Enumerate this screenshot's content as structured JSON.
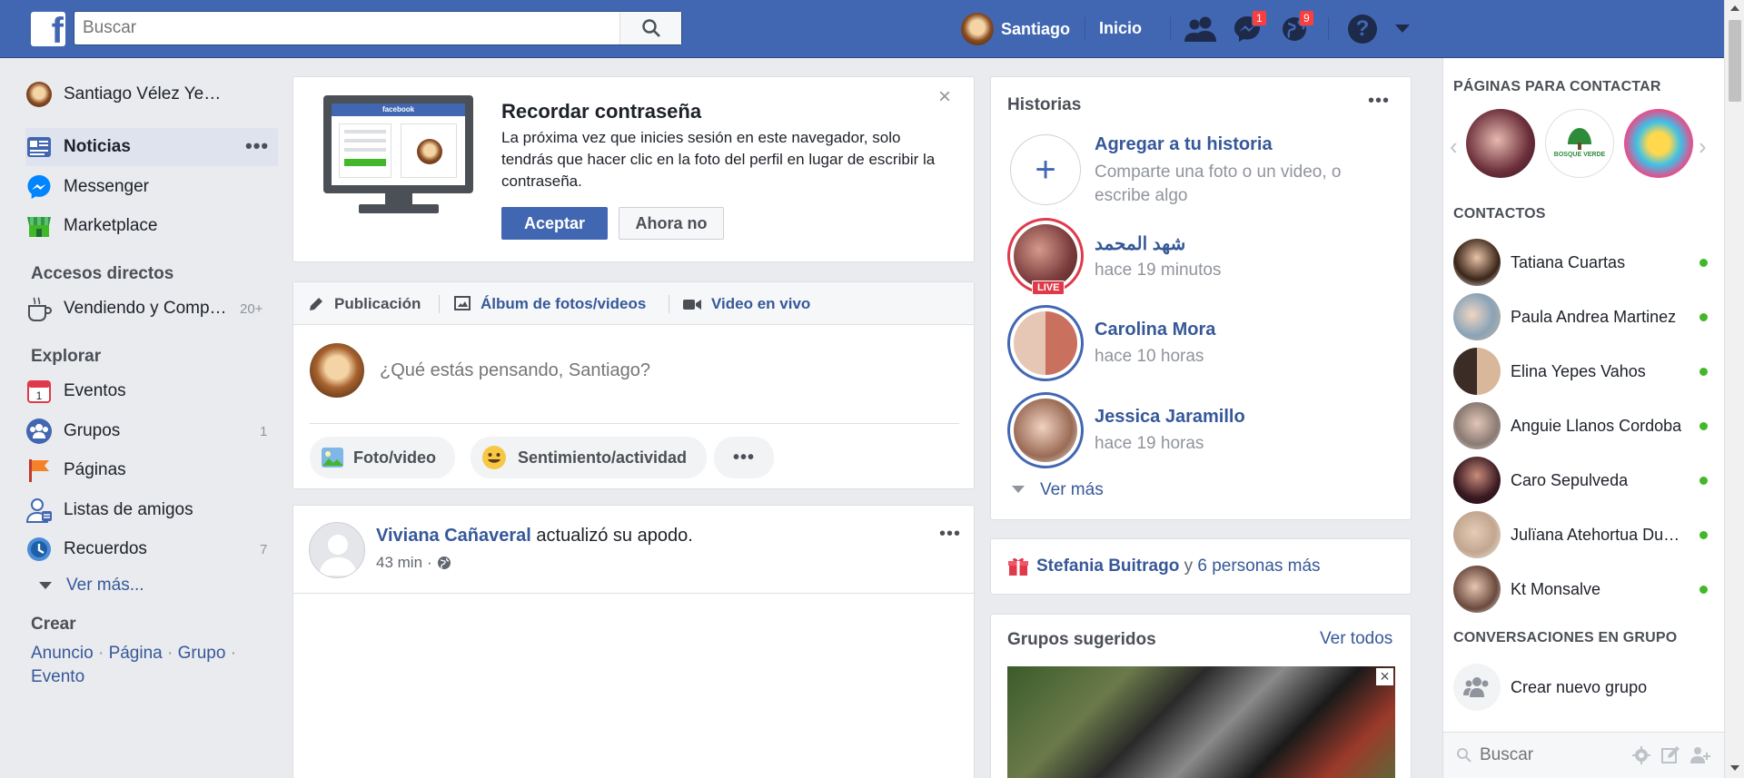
{
  "topbar": {
    "search_placeholder": "Buscar",
    "user_name": "Santiago",
    "home_label": "Inicio",
    "messages_badge": "1",
    "notifications_badge": "9"
  },
  "left_nav": {
    "profile_name": "Santiago Vélez Ye…",
    "items": [
      {
        "label": "Noticias",
        "icon": "news-feed-icon"
      },
      {
        "label": "Messenger",
        "icon": "messenger-icon"
      },
      {
        "label": "Marketplace",
        "icon": "marketplace-icon"
      }
    ],
    "shortcuts_heading": "Accesos directos",
    "shortcut": {
      "label": "Vendiendo y Comp…",
      "count": "20+"
    },
    "explore_heading": "Explorar",
    "explore_items": [
      {
        "label": "Eventos",
        "count": ""
      },
      {
        "label": "Grupos",
        "count": "1"
      },
      {
        "label": "Páginas",
        "count": ""
      },
      {
        "label": "Listas de amigos",
        "count": ""
      },
      {
        "label": "Recuerdos",
        "count": "7"
      }
    ],
    "see_more": "Ver más...",
    "create_heading": "Crear",
    "create_links": [
      "Anuncio",
      "Página",
      "Grupo",
      "Evento"
    ]
  },
  "password_card": {
    "title": "Recordar contraseña",
    "body": "La próxima vez que inicies sesión en este navegador, solo tendrás que hacer clic en la foto del perfil en lugar de escribir la contraseña.",
    "accept_label": "Aceptar",
    "decline_label": "Ahora no",
    "mock_logo": "facebook"
  },
  "composer": {
    "tabs": [
      {
        "label": "Publicación"
      },
      {
        "label": "Álbum de fotos/videos"
      },
      {
        "label": "Video en vivo"
      }
    ],
    "placeholder": "¿Qué estás pensando, Santiago?",
    "actions": [
      {
        "label": "Foto/video"
      },
      {
        "label": "Sentimiento/actividad"
      }
    ]
  },
  "post": {
    "author": "Viviana Cañaveral",
    "action": "actualizó su apodo.",
    "time": "43 min",
    "separator": "·"
  },
  "stories": {
    "heading": "Historias",
    "add_title": "Agregar a tu historia",
    "add_subtitle": "Comparte una foto o un video, o escribe algo",
    "items": [
      {
        "name": "شهد المحمد",
        "time": "hace 19 minutos",
        "live": "LIVE"
      },
      {
        "name": "Carolina Mora",
        "time": "hace 10 horas"
      },
      {
        "name": "Jessica Jaramillo",
        "time": "hace 19 horas"
      }
    ],
    "see_more": "Ver más"
  },
  "birthday": {
    "name": "Stefania Buitrago",
    "connector": "y",
    "others": "6 personas más"
  },
  "groups": {
    "heading": "Grupos sugeridos",
    "see_all": "Ver todos"
  },
  "right_sidebar": {
    "pages_heading": "PÁGINAS PARA CONTACTAR",
    "page_logo_text": "BOSQUE VERDE",
    "contacts_heading": "CONTACTOS",
    "contacts": [
      {
        "name": "Tatiana Cuartas"
      },
      {
        "name": "Paula Andrea Martinez"
      },
      {
        "name": "Elina Yepes Vahos"
      },
      {
        "name": "Anguie Llanos Cordoba"
      },
      {
        "name": "Caro Sepulveda"
      },
      {
        "name": "Julïana Atehortua Du…"
      },
      {
        "name": "Kt Monsalve"
      }
    ],
    "group_conv_heading": "CONVERSACIONES EN GRUPO",
    "create_group": "Crear nuevo grupo",
    "search_placeholder": "Buscar"
  },
  "colors": {
    "brand_blue": "#4267b2",
    "link_blue": "#365899",
    "online_green": "#42b72a",
    "badge_red": "#fa3e3e"
  }
}
